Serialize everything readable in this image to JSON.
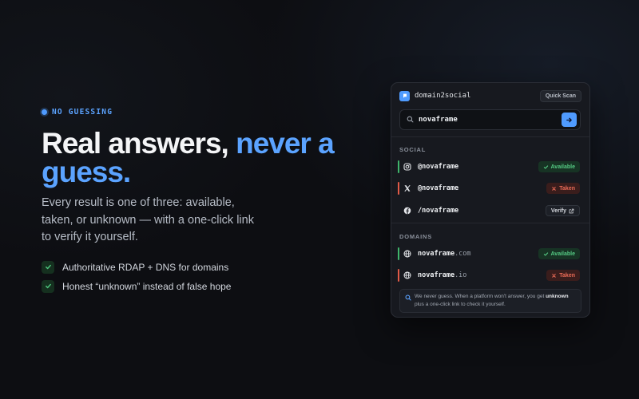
{
  "hero": {
    "eyebrow": "NO GUESSING",
    "headline_plain": "Real answers,",
    "headline_accent": "never a guess.",
    "lead": "Every result is one of three: available, taken, or unknown — with a one-click link to verify it yourself.",
    "bullets": [
      "Authoritative RDAP + DNS for domains",
      "Honest “unknown” instead of false hope"
    ]
  },
  "card": {
    "app_name": "domain2social",
    "quick_scan_label": "Quick Scan",
    "search_value": "novaframe",
    "social_label": "SOCIAL",
    "social": [
      {
        "icon": "instagram-icon",
        "handle": "@novaframe",
        "status": "Available"
      },
      {
        "icon": "x-icon",
        "handle": "@novaframe",
        "status": "Taken"
      },
      {
        "icon": "facebook-icon",
        "handle": "/novaframe",
        "status": "Verify"
      }
    ],
    "domains_label": "DOMAINS",
    "domains": [
      {
        "icon": "globe-icon",
        "name": "novaframe",
        "tld": ".com",
        "status": "Available"
      },
      {
        "icon": "globe-icon",
        "name": "novaframe",
        "tld": ".io",
        "status": "Taken"
      }
    ],
    "note_before": "We never guess. When a platform won't answer, you get ",
    "note_bold": "unknown",
    "note_after": " plus a one-click link to check it yourself."
  },
  "colors": {
    "accent": "#4f9bff",
    "available": "#55c983",
    "taken": "#ea6b57",
    "background": "#0d0e12"
  }
}
